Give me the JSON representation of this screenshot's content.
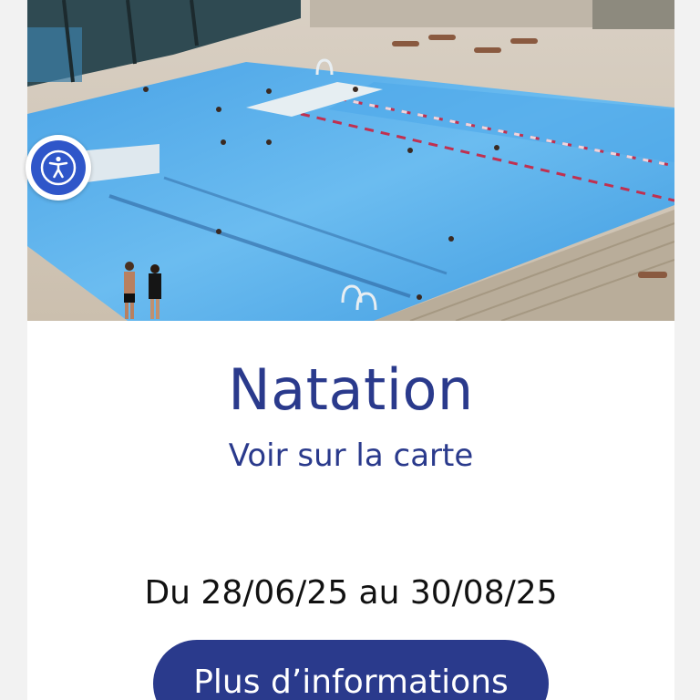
{
  "activity": {
    "title": "Natation",
    "map_link": "Voir sur la carte",
    "dates": "Du 28/06/25 au 30/08/25",
    "more_button": "Plus d’informations"
  },
  "hero_image": {
    "subject": "outdoor-swimming-pool-photo"
  },
  "accessibility": {
    "icon": "accessibility-person-icon"
  },
  "colors": {
    "brand": "#2a3a8c",
    "accessibility_button": "#2f56c9",
    "pool_water": "#5aaee8"
  }
}
